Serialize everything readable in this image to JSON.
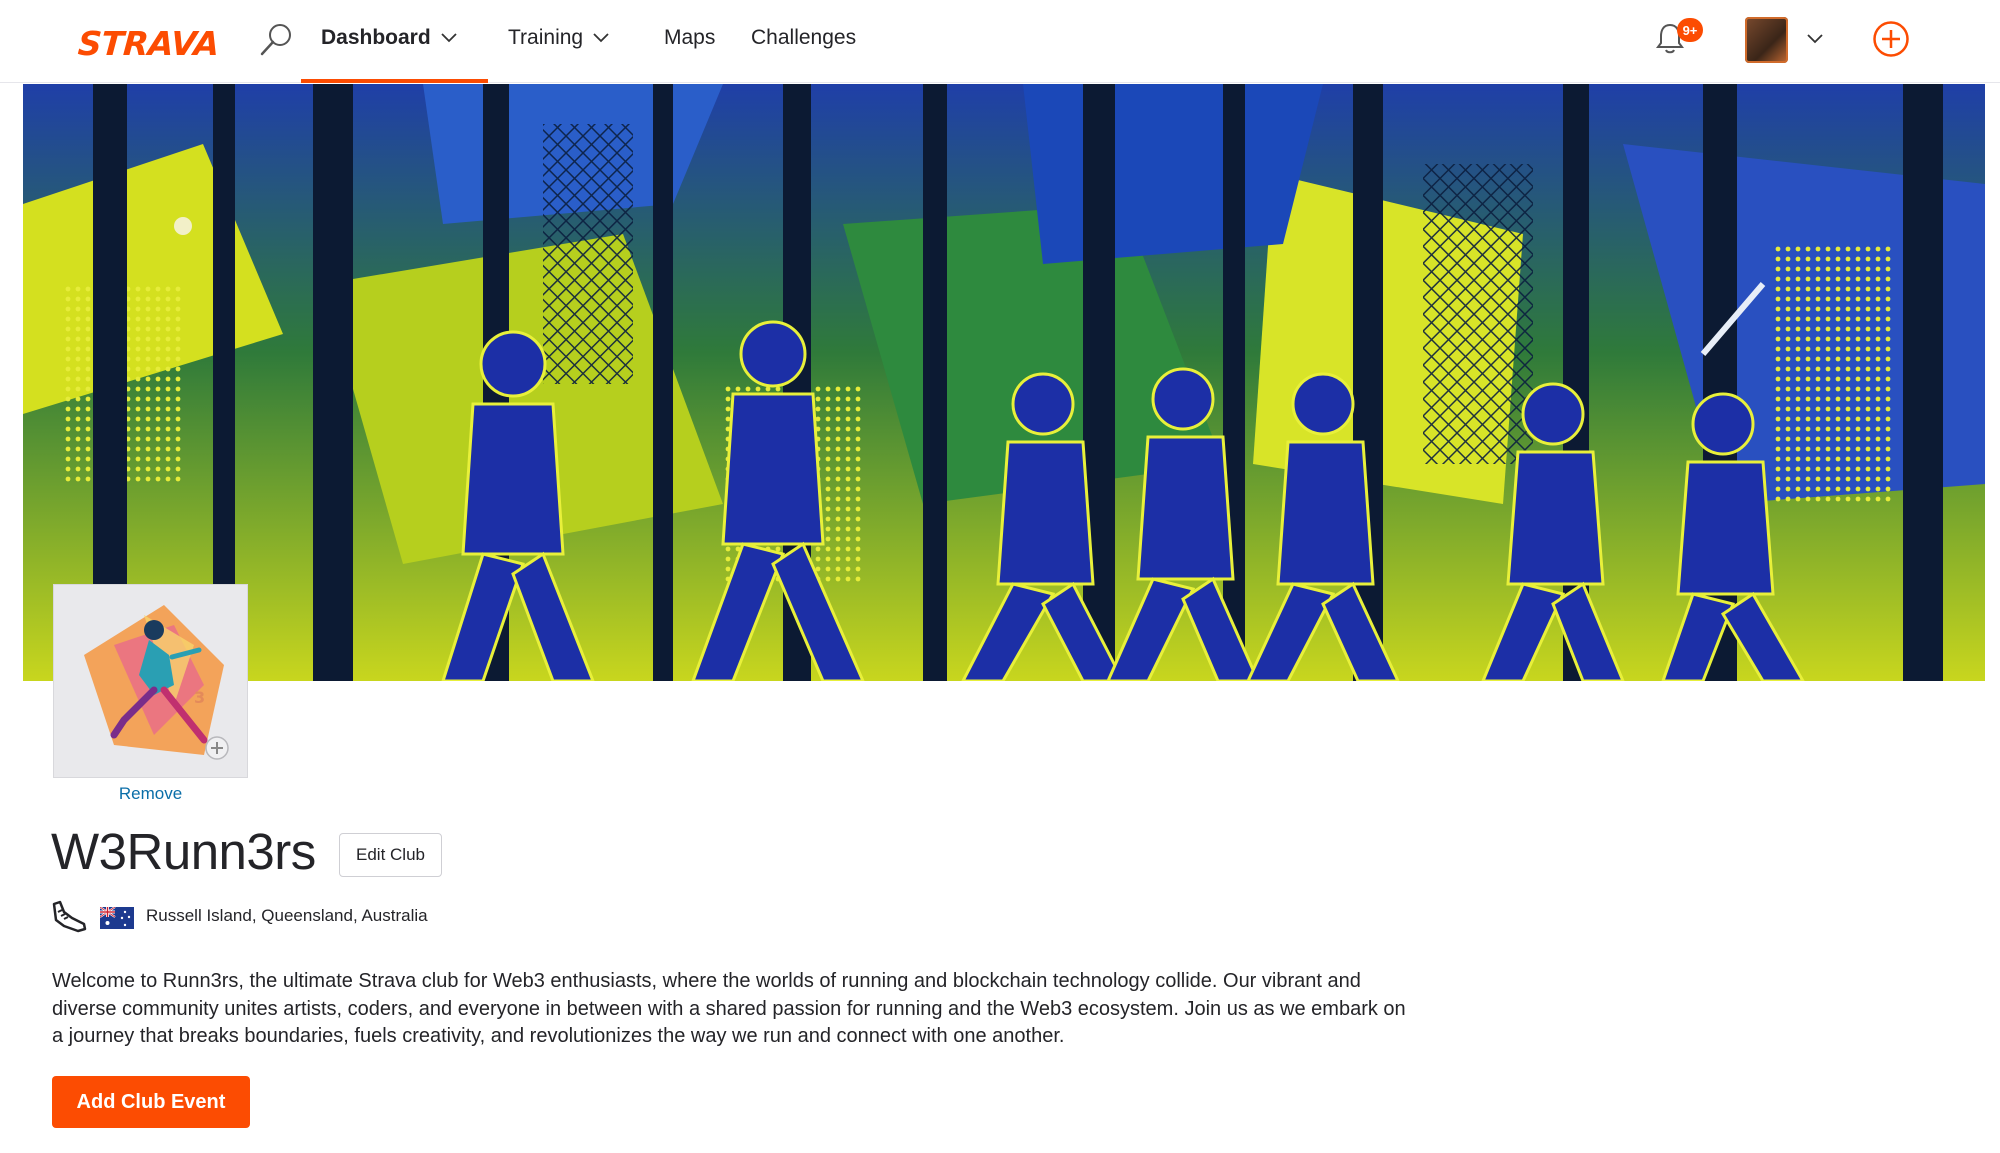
{
  "nav": {
    "logo": "STRAVA",
    "dashboard_label": "Dashboard",
    "training_label": "Training",
    "maps_label": "Maps",
    "challenges_label": "Challenges",
    "notification_count": "9+",
    "accent_color": "#fc4c02"
  },
  "club": {
    "remove_label": "Remove",
    "name": "W3Runn3rs",
    "edit_label": "Edit Club",
    "sport_icon": "running-shoe-icon",
    "flag_icon": "australia-flag-icon",
    "location": "Russell Island, Queensland, Australia",
    "description": "Welcome to Runn3rs, the ultimate Strava club for Web3 enthusiasts, where the worlds of running and blockchain technology collide. Our vibrant and diverse community unites artists, coders, and everyone in between with a shared passion for running and the Web3 ecosystem. Join us as we embark on a journey that breaks boundaries, fuels creativity, and revolutionizes the way we run and connect with one another.",
    "add_event_label": "Add Club Event"
  }
}
